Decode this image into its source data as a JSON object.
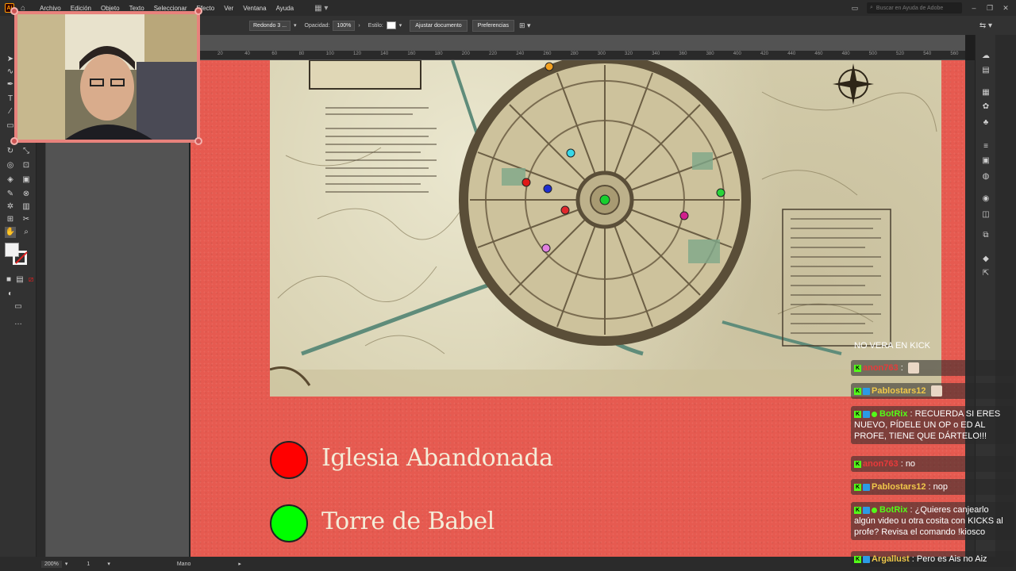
{
  "app": {
    "logo": "Ai",
    "menus": [
      "Archivo",
      "Edición",
      "Objeto",
      "Texto",
      "Seleccionar",
      "Efecto",
      "Ver",
      "Ventana",
      "Ayuda"
    ],
    "help_placeholder": "Buscar en Ayuda de Adobe"
  },
  "controlbar": {
    "stroke_profile": "Redondo 3 ...",
    "opacity_label": "Opacidad:",
    "opacity_value": "100%",
    "style_label": "Estilo:",
    "fit_document": "Ajustar documento",
    "preferences": "Preferencias"
  },
  "ruler": {
    "ticks": [
      "20",
      "40",
      "60",
      "80",
      "100",
      "120",
      "140",
      "160",
      "180",
      "200",
      "220",
      "240",
      "260",
      "280",
      "300",
      "320",
      "340",
      "360",
      "380",
      "400",
      "420",
      "440",
      "460",
      "480",
      "500",
      "520",
      "540",
      "560"
    ]
  },
  "legend": [
    {
      "label": "Iglesia Abandonada",
      "color": "#ff0000"
    },
    {
      "label": "Torre de Babel",
      "color": "#00ff00"
    }
  ],
  "map_markers": [
    {
      "name": "orange",
      "color": "#f2a01f"
    },
    {
      "name": "cyan",
      "color": "#37d8e8"
    },
    {
      "name": "red",
      "color": "#e01818"
    },
    {
      "name": "blue",
      "color": "#1f2fd0"
    },
    {
      "name": "red-center",
      "color": "#e0282c"
    },
    {
      "name": "green-center",
      "color": "#18d02e"
    },
    {
      "name": "green-east",
      "color": "#28d43a"
    },
    {
      "name": "magenta",
      "color": "#d0208c"
    },
    {
      "name": "pink",
      "color": "#e080e0"
    }
  ],
  "status": {
    "zoom": "200%",
    "artboard": "1",
    "tool": "Mano"
  },
  "chat": {
    "banner": "NO VERA EN KICK",
    "messages": [
      {
        "user": "anon763",
        "user_color": "#e83a3a",
        "text": "",
        "emote": true,
        "badges": [
          "kick"
        ]
      },
      {
        "user": "Pablostars12",
        "user_color": "#f0c84a",
        "text": "",
        "emote": true,
        "badges": [
          "kick",
          "mod"
        ]
      },
      {
        "user": "BotRix",
        "user_color": "#53fc18",
        "text": "RECUERDA SI ERES NUEVO, PÍDELE UN OP o ED AL PROFE, TIENE QUE DÁRTELO!!!",
        "emote": false,
        "badges": [
          "kick",
          "mod",
          "verified"
        ]
      },
      {
        "user": "anon763",
        "user_color": "#e83a3a",
        "text": "no",
        "emote": false,
        "badges": [
          "kick"
        ]
      },
      {
        "user": "Pablostars12",
        "user_color": "#f0c84a",
        "text": "nop",
        "emote": false,
        "badges": [
          "kick",
          "mod"
        ]
      },
      {
        "user": "BotRix",
        "user_color": "#53fc18",
        "text": "¿Quieres canjearlo algún video u otra cosita con KICKS al profe? Revisa el comando !kiosco",
        "emote": false,
        "badges": [
          "kick",
          "mod",
          "verified"
        ]
      },
      {
        "user": "Argallust",
        "user_color": "#f0c84a",
        "text": "Pero es Ais no Aiz",
        "emote": false,
        "badges": [
          "kick",
          "mod"
        ]
      }
    ]
  }
}
